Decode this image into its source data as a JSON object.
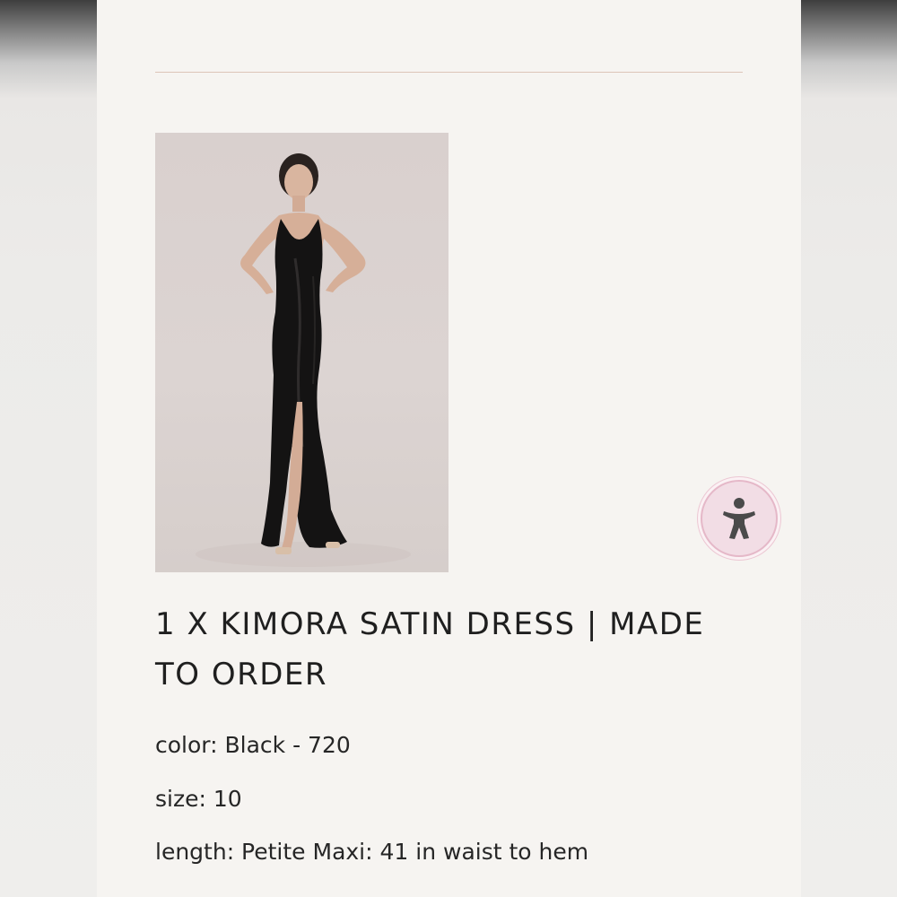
{
  "product": {
    "title": "1 X KIMORA SATIN DRESS | MADE TO ORDER",
    "image_description": "Model in black satin maxi dress",
    "details": {
      "color": "color: Black - 720",
      "size": "size: 10",
      "length": "length: Petite Maxi: 41 in waist to hem"
    }
  },
  "accessibility_button": {
    "icon": "accessibility-person-icon"
  },
  "colors": {
    "card_background": "#f6f4f1",
    "divider": "#dcc5b8",
    "text": "#1f1f1f",
    "accessibility_bg": "#f2dde5",
    "accessibility_icon": "#4a4a4a"
  }
}
